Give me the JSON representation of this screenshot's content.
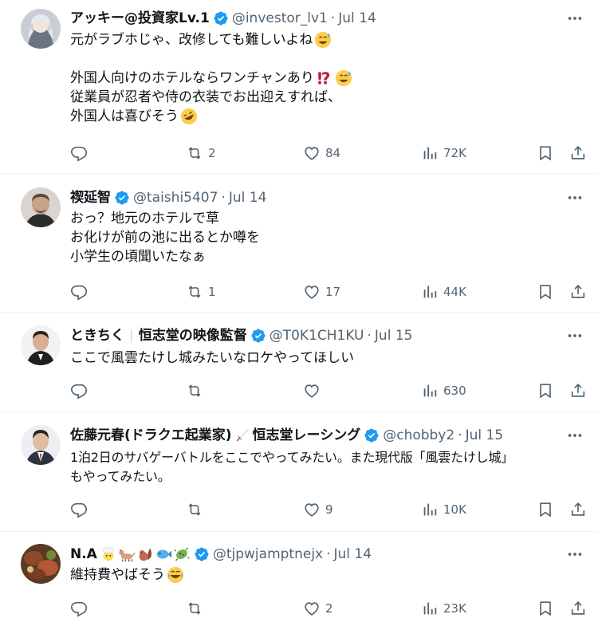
{
  "tweets": [
    {
      "name": "アッキー@投資家Lv.1",
      "handle": "@investor_lv1",
      "date": "Jul 14",
      "lines": [
        "元がラブホじゃ、改修しても難しいよね",
        "",
        "外国人向けのホテルならワンチャンあり",
        "従業員が忍者や侍の衣装でお出迎えすれば、",
        "外国人は喜びそう"
      ],
      "replies": "",
      "reposts": "2",
      "likes": "84",
      "views": "72K"
    },
    {
      "name": "禊延智",
      "handle": "@taishi5407",
      "date": "Jul 14",
      "lines": [
        "おっ？地元のホテルで草",
        "お化けが前の池に出るとか噂を",
        "小学生の頃聞いたなぁ"
      ],
      "replies": "",
      "reposts": "1",
      "likes": "17",
      "views": "44K"
    },
    {
      "name": "ときちく",
      "affiliation": "恒志堂の映像監督",
      "handle": "@T0K1CH1KU",
      "date": "Jul 15",
      "lines": [
        "ここで風雲たけし城みたいなロケやってほしい"
      ],
      "replies": "",
      "reposts": "",
      "likes": "",
      "views": "630"
    },
    {
      "name": "佐藤元春(ドラクエ起業家)",
      "affiliation": "恒志堂レーシング",
      "handle": "@chobby2",
      "date": "Jul 15",
      "lines": [
        "1泊2日のサバゲーバトルをここでやってみたい。また現代版「風雲たけし城」",
        "もやってみたい。"
      ],
      "replies": "",
      "reposts": "",
      "likes": "9",
      "views": "10K"
    },
    {
      "name": "N.A",
      "handle": "@tjpwjamptnejx",
      "date": "Jul 14",
      "lines": [
        "維持費やばそう"
      ],
      "replies": "",
      "reposts": "",
      "likes": "2",
      "views": "23K"
    }
  ],
  "icons": {
    "reply": "reply-icon",
    "repost": "repost-icon",
    "like": "heart-icon",
    "views": "views-icon",
    "bookmark": "bookmark-icon",
    "share": "share-icon",
    "verified": "verified-badge-icon",
    "more": "more-icon"
  },
  "colors": {
    "text": "#0f1419",
    "secondary": "#536471",
    "verified": "#1d9bf0",
    "border": "#eff3f4"
  }
}
